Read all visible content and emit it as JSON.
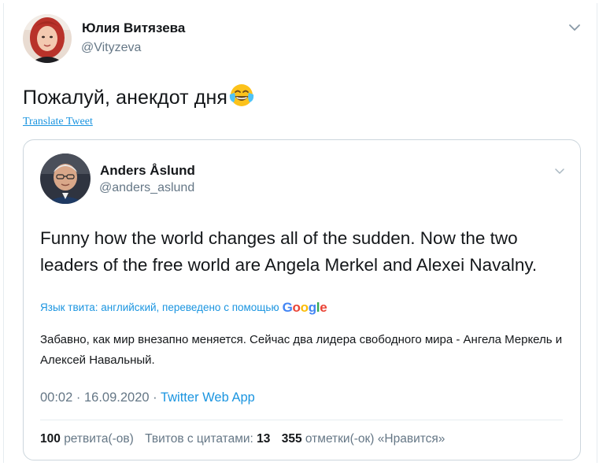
{
  "tweet": {
    "author_name": "Юлия Витязева",
    "author_handle": "@Vityzeva",
    "text": "Пожалуй, анекдот дня",
    "emoji": "face-with-tears-of-joy-icon",
    "translate_label": "Translate Tweet"
  },
  "quoted": {
    "author_name": "Anders Åslund",
    "author_handle": "@anders_aslund",
    "text": "Funny how the world changes all of the sudden. Now the two leaders of the free world are Angela Merkel and Alexei Navalny.",
    "language_note": "Язык твита: английский, переведено с помощью",
    "translator": "Google",
    "translated_text": "Забавно, как мир внезапно меняется. Сейчас два лидера свободного мира - Ангела Меркель и Алексей Навальный.",
    "time": "00:02",
    "date": "16.09.2020",
    "sep": "·",
    "source": "Twitter Web App",
    "stats": {
      "retweets_count": "100",
      "retweets_label": "ретвита(-ов)",
      "quotes_label": "Твитов с цитатами:",
      "quotes_count": "13",
      "likes_count": "355",
      "likes_label": "отметки(-ок) «Нравится»"
    }
  },
  "colors": {
    "link": "#1b95e0",
    "muted": "#657786",
    "text": "#14171a",
    "border": "#ccd6dd"
  }
}
